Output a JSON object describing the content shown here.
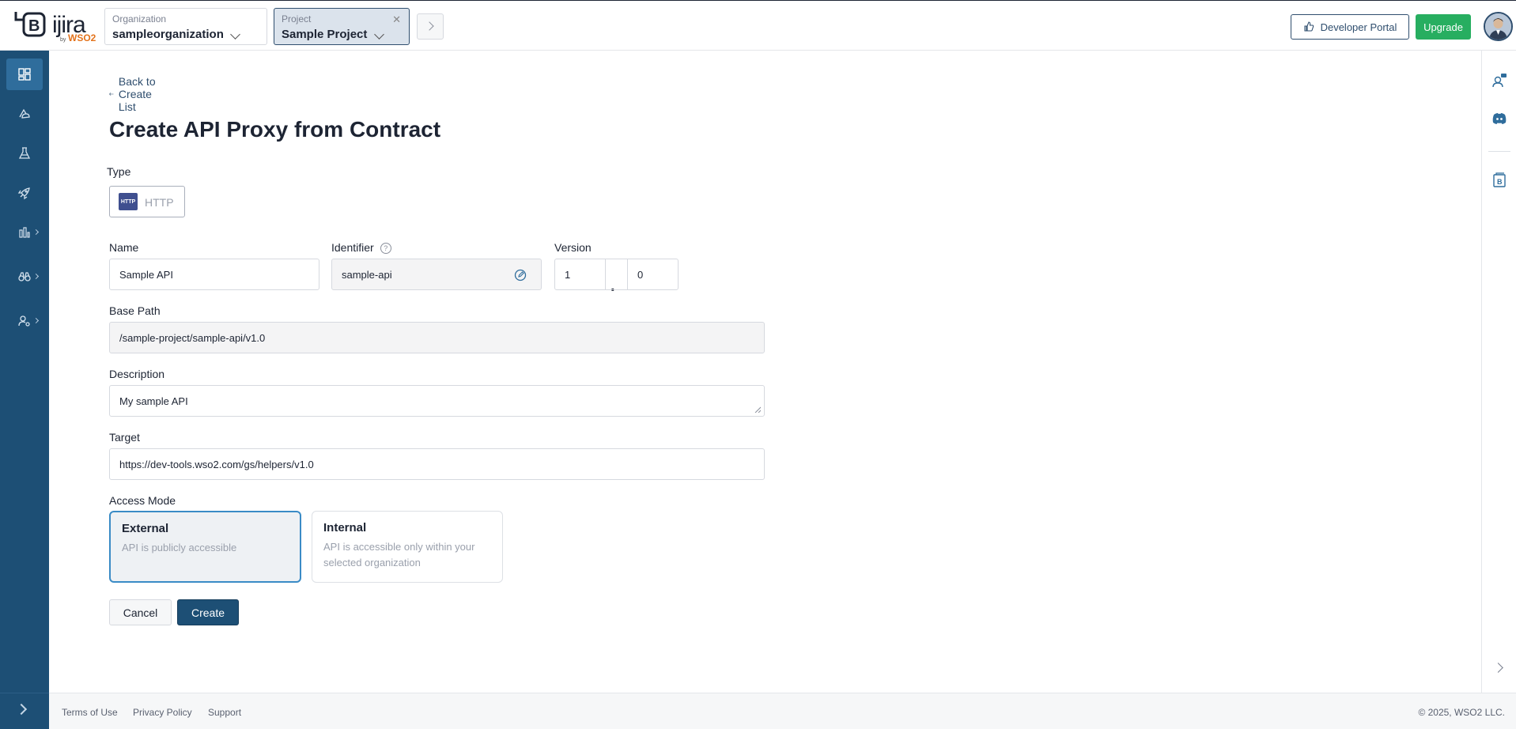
{
  "brand": {
    "name": "ijira",
    "by": "by",
    "vendor": "WSO2",
    "logo_letter": "B"
  },
  "header": {
    "organization": {
      "label": "Organization",
      "value": "sampleorganization"
    },
    "project": {
      "label": "Project",
      "value": "Sample Project"
    },
    "developer_portal_label": "Developer Portal",
    "upgrade_label": "Upgrade"
  },
  "page": {
    "back_link": "Back to Create List",
    "title": "Create API Proxy from Contract",
    "type": {
      "label": "Type",
      "value": "HTTP",
      "badge": "HTTP"
    },
    "name": {
      "label": "Name",
      "value": "Sample API"
    },
    "identifier": {
      "label": "Identifier",
      "value": "sample-api"
    },
    "version": {
      "label": "Version",
      "major": "1",
      "separator": ".",
      "minor": "0"
    },
    "base_path": {
      "label": "Base Path",
      "value": "/sample-project/sample-api/v1.0"
    },
    "description": {
      "label": "Description",
      "value": "My sample API"
    },
    "target": {
      "label": "Target",
      "value": "https://dev-tools.wso2.com/gs/helpers/v1.0"
    },
    "access_mode": {
      "label": "Access Mode",
      "options": [
        {
          "title": "External",
          "desc": "API is publicly accessible",
          "selected": true
        },
        {
          "title": "Internal",
          "desc": "API is accessible only within your selected organization",
          "selected": false
        }
      ]
    },
    "cancel_label": "Cancel",
    "create_label": "Create"
  },
  "sidebar_icons": [
    "overview-icon",
    "develop-icon",
    "test-icon",
    "deploy-icon",
    "insights-icon",
    "observability-icon",
    "admin-icon"
  ],
  "footer": {
    "terms": "Terms of Use",
    "privacy": "Privacy Policy",
    "support": "Support",
    "copyright": "© 2025, WSO2 LLC."
  },
  "colors": {
    "sidebar": "#1d4f75",
    "primary": "#1d4f75",
    "upgrade": "#27ae60",
    "selected_border": "#3a8bc6"
  }
}
